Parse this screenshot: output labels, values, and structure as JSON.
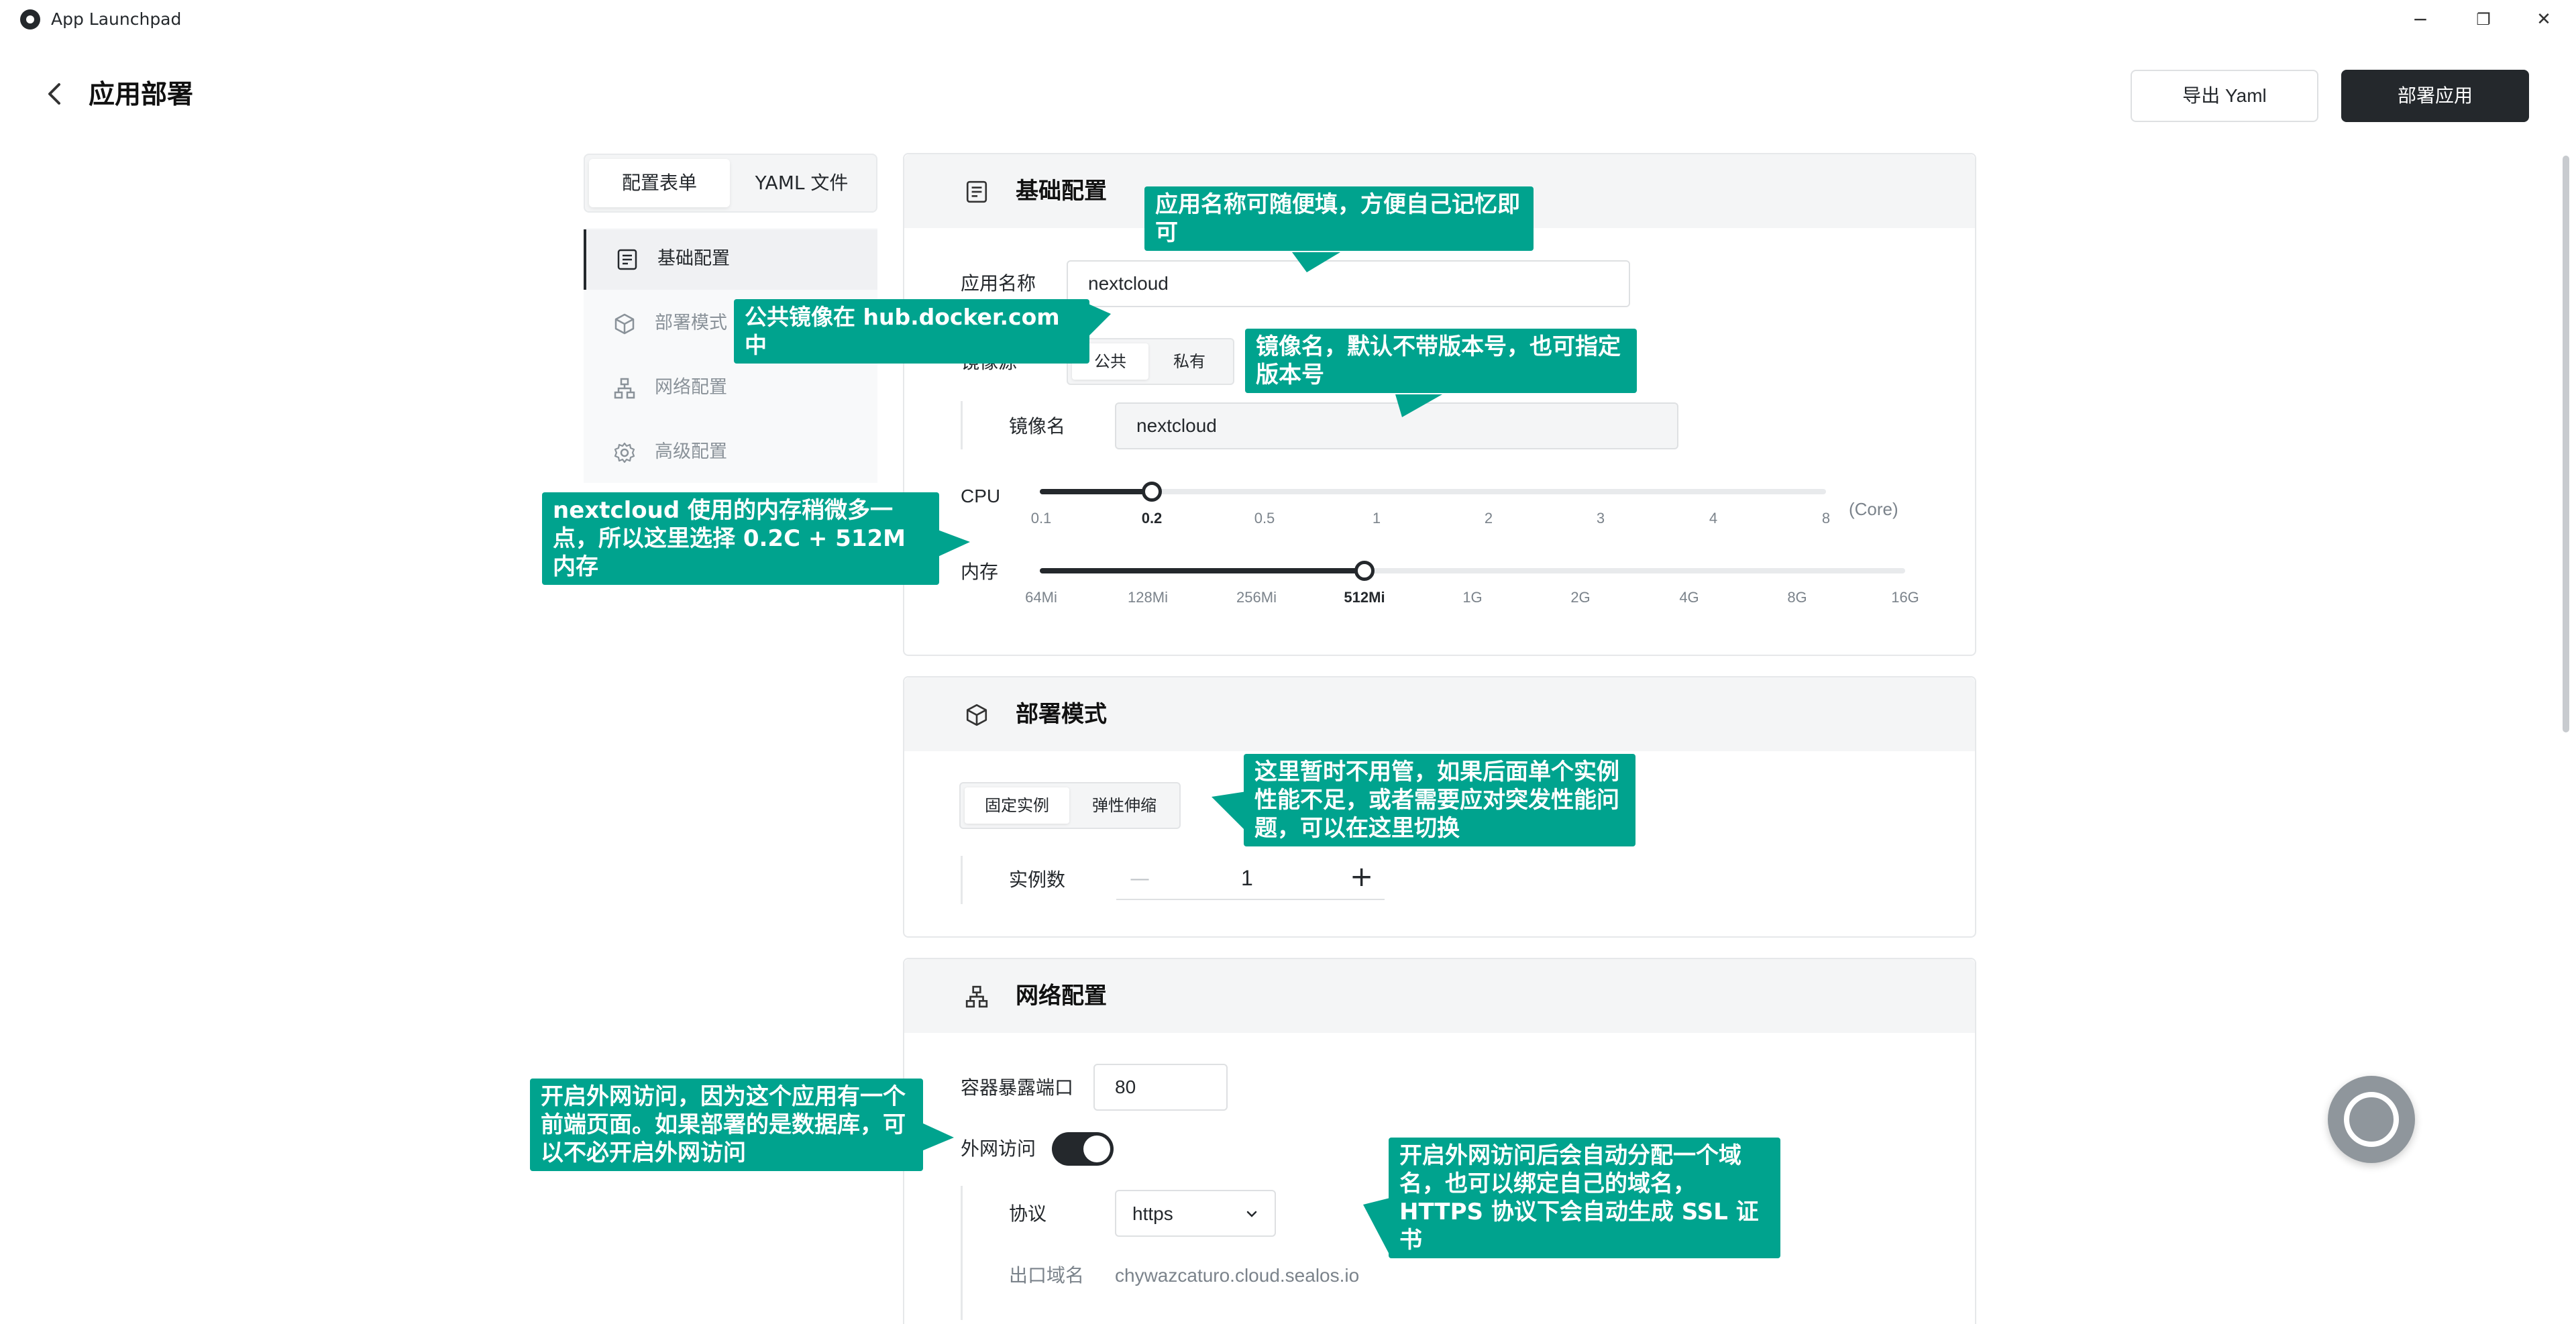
{
  "window": {
    "title": "App Launchpad",
    "controls": {
      "minimize": "−",
      "maximize": "❐",
      "close": "✕"
    }
  },
  "header": {
    "back_icon": "back-arrow-icon",
    "title": "应用部署",
    "export_label": "导出 Yaml",
    "deploy_label": "部署应用"
  },
  "left_tabs": {
    "form": "配置表单",
    "yaml": "YAML 文件"
  },
  "nav": [
    {
      "label": "基础配置",
      "icon": "document-icon",
      "active": true
    },
    {
      "label": "部署模式",
      "icon": "cube-icon",
      "active": false
    },
    {
      "label": "网络配置",
      "icon": "network-icon",
      "active": false
    },
    {
      "label": "高级配置",
      "icon": "gear-icon",
      "active": false
    }
  ],
  "basic": {
    "title": "基础配置",
    "app_name_label": "应用名称",
    "app_name_value": "nextcloud",
    "image_source_label": "镜像源",
    "image_source_options": [
      "公共",
      "私有"
    ],
    "image_source_selected": "公共",
    "image_name_label": "镜像名",
    "image_name_value": "nextcloud",
    "cpu_label": "CPU",
    "cpu_ticks": [
      "0.1",
      "0.2",
      "0.5",
      "1",
      "2",
      "3",
      "4",
      "8"
    ],
    "cpu_selected": "0.2",
    "cpu_unit": "(Core)",
    "mem_label": "内存",
    "mem_ticks": [
      "64Mi",
      "128Mi",
      "256Mi",
      "512Mi",
      "1G",
      "2G",
      "4G",
      "8G",
      "16G"
    ],
    "mem_selected": "512Mi"
  },
  "deploy": {
    "title": "部署模式",
    "modes": [
      "固定实例",
      "弹性伸缩"
    ],
    "mode_selected": "固定实例",
    "instances_label": "实例数",
    "instances_value": "1",
    "minus": "—",
    "plus": "+"
  },
  "network": {
    "title": "网络配置",
    "port_label": "容器暴露端口",
    "port_value": "80",
    "public_access_label": "外网访问",
    "public_access_on": true,
    "protocol_label": "协议",
    "protocol_value": "https",
    "domain_label": "出口域名",
    "domain_value": "chywazcaturo.cloud.sealos.io"
  },
  "callouts": {
    "app_name": "应用名称可随便填，方便自己记忆即可",
    "public_image": "公共镜像在 hub.docker.com 中",
    "image_name": "镜像名，默认不带版本号，也可指定版本号",
    "memory": "nextcloud 使用的内存稍微多一点，所以这里选择 0.2C + 512M 内存",
    "deploy_mode": "这里暂时不用管，如果后面单个实例性能不足，或者需要应对突发性能问题，可以在这里切换",
    "public_access": "开启外网访问，因为这个应用有一个前端页面。如果部署的是数据库，可以不必开启外网访问",
    "domain": "开启外网访问后会自动分配一个域名，也可以绑定自己的域名，HTTPS 协议下会自动生成 SSL 证书"
  },
  "colors": {
    "callout": "#00a38e",
    "primary_dark": "#24282c",
    "card_header": "#f4f5f6"
  }
}
